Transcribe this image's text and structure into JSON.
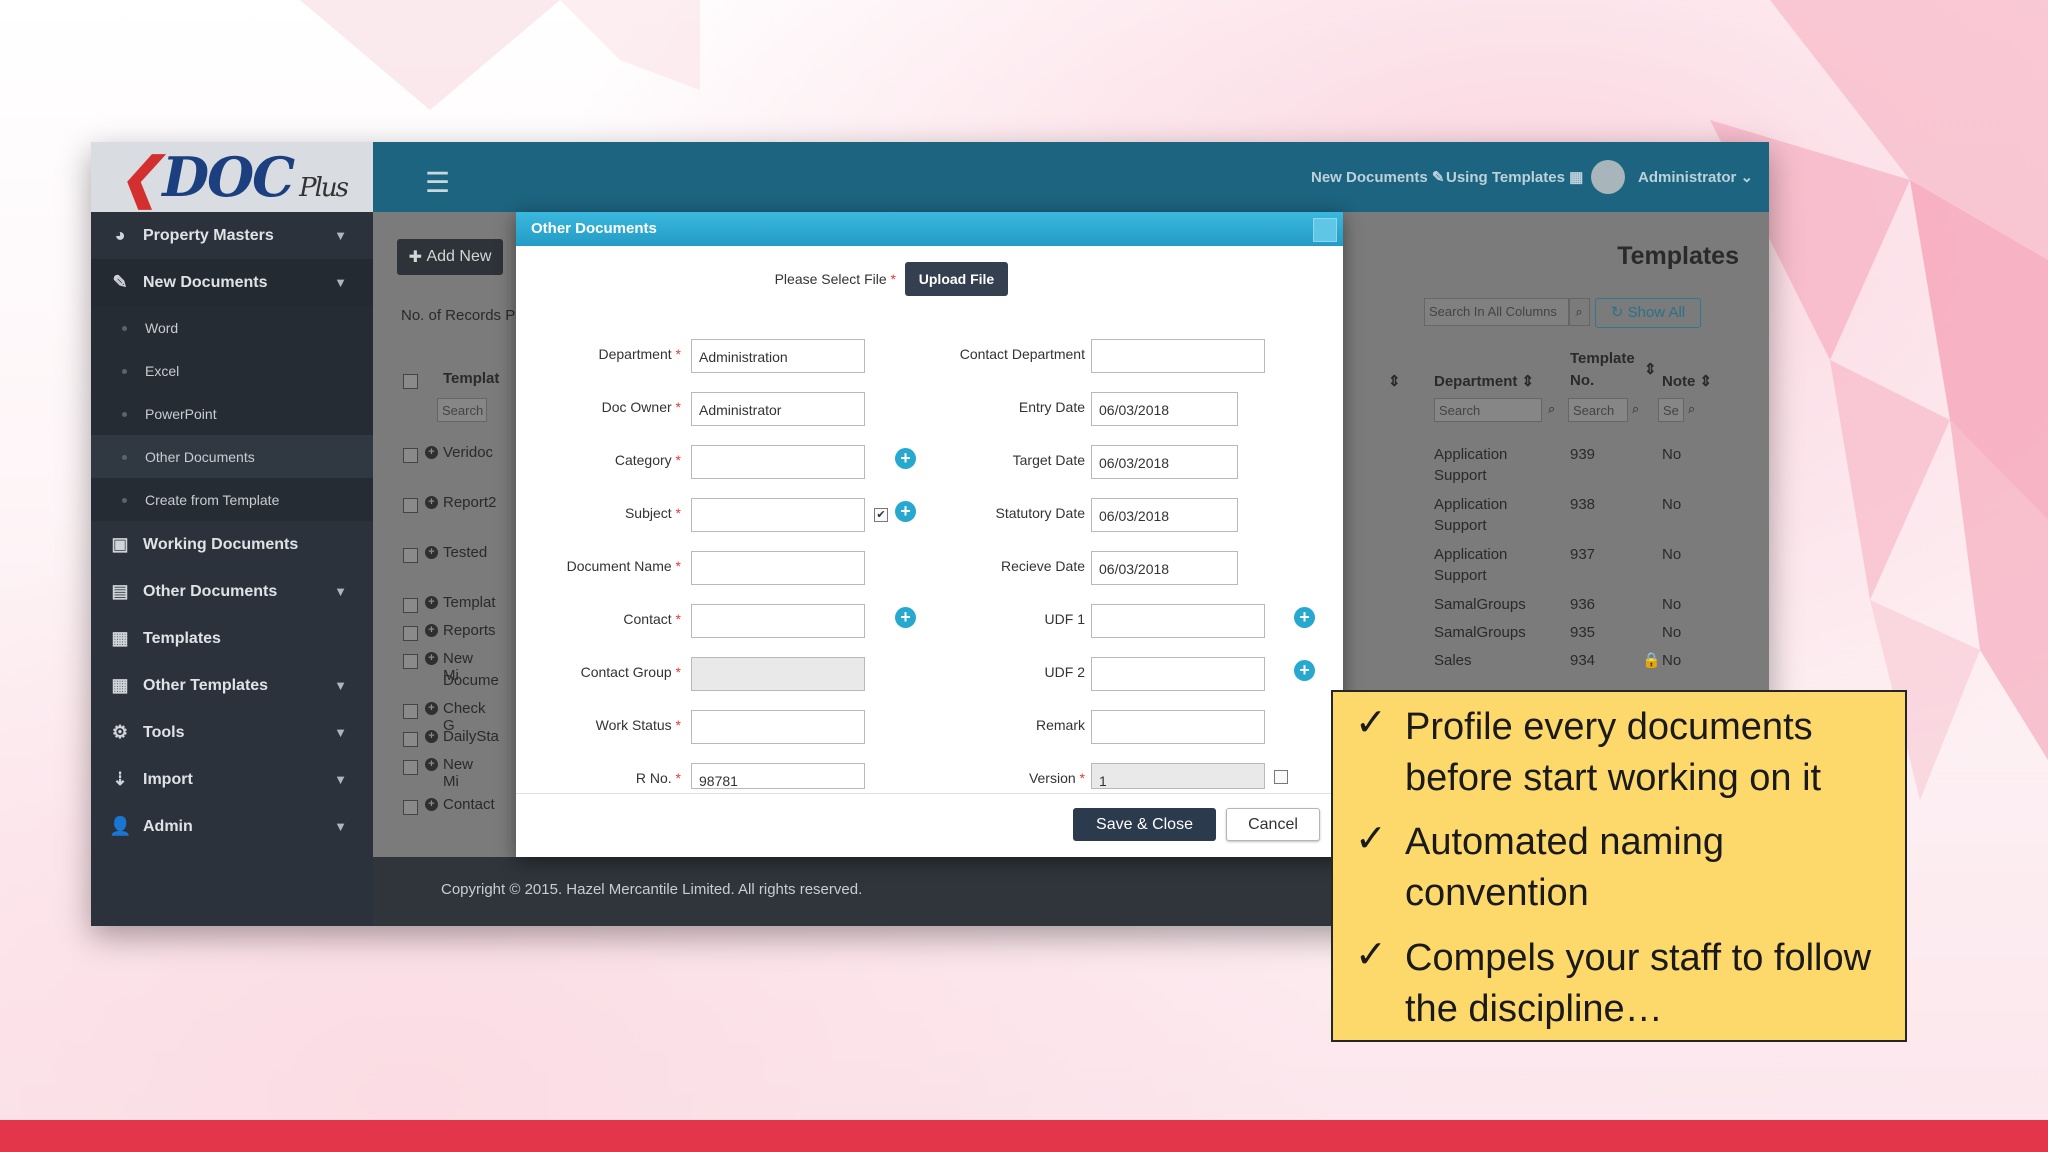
{
  "app": {
    "logo_text": "DOC",
    "logo_suffix": "Plus"
  },
  "sidebar": {
    "items": [
      {
        "label": "Property Masters",
        "icon": "dashboard-icon"
      },
      {
        "label": "New Documents",
        "icon": "edit-icon"
      },
      {
        "label": "Working Documents",
        "icon": "excel-file-icon"
      },
      {
        "label": "Other Documents",
        "icon": "file-icon"
      },
      {
        "label": "Templates",
        "icon": "grid-icon"
      },
      {
        "label": "Other Templates",
        "icon": "table-icon"
      },
      {
        "label": "Tools",
        "icon": "gear-icon"
      },
      {
        "label": "Import",
        "icon": "import-icon"
      },
      {
        "label": "Admin",
        "icon": "user-icon"
      }
    ],
    "sub_items": [
      "Word",
      "Excel",
      "PowerPoint",
      "Other Documents",
      "Create from Template"
    ]
  },
  "topbar": {
    "new_documents": "New Documents",
    "using_templates": "Using Templates",
    "user": "Administrator"
  },
  "page": {
    "add_new": "Add New",
    "records_label": "No. of Records P",
    "title": "Templates",
    "search_all_placeholder": "Search In All Columns",
    "show_all": "Show All"
  },
  "left_table": {
    "header": "Templat",
    "search": "Search",
    "rows": [
      "Veridoc",
      "Report2",
      "Tested",
      "Templat",
      "Reports",
      "New Mi",
      "Docume",
      "Check G",
      "DailySta",
      "New Mi",
      "Contact"
    ]
  },
  "right_table": {
    "headers": {
      "department": "Department",
      "template_no_1": "Template",
      "template_no_2": "No.",
      "note": "Note"
    },
    "search": "Search",
    "search_short": "Se",
    "rows": [
      {
        "dept1": "Application",
        "dept2": "Support",
        "no": "939",
        "note": "No"
      },
      {
        "dept1": "Application",
        "dept2": "Support",
        "no": "938",
        "note": "No"
      },
      {
        "dept1": "Application",
        "dept2": "Support",
        "no": "937",
        "note": "No"
      },
      {
        "dept1": "SamalGroups",
        "dept2": "",
        "no": "936",
        "note": "No"
      },
      {
        "dept1": "SamalGroups",
        "dept2": "",
        "no": "935",
        "note": "No"
      },
      {
        "dept1": "Sales",
        "dept2": "",
        "no": "934",
        "note": "No"
      }
    ]
  },
  "footer": {
    "text": "Copyright © 2015. Hazel Mercantile Limited. All rights reserved."
  },
  "modal": {
    "title": "Other Documents",
    "select_file_label": "Please Select File",
    "upload_button": "Upload File",
    "fields": {
      "department": {
        "label": "Department",
        "value": "Administration"
      },
      "doc_owner": {
        "label": "Doc Owner",
        "value": "Administrator"
      },
      "category": {
        "label": "Category",
        "value": ""
      },
      "subject": {
        "label": "Subject",
        "value": ""
      },
      "document_name": {
        "label": "Document Name",
        "value": ""
      },
      "contact": {
        "label": "Contact",
        "value": ""
      },
      "contact_group": {
        "label": "Contact Group",
        "value": ""
      },
      "work_status": {
        "label": "Work Status",
        "value": ""
      },
      "r_no": {
        "label": "R No.",
        "value": "98781"
      },
      "contact_department": {
        "label": "Contact Department",
        "value": ""
      },
      "entry_date": {
        "label": "Entry Date",
        "value": "06/03/2018"
      },
      "target_date": {
        "label": "Target Date",
        "value": "06/03/2018"
      },
      "statutory_date": {
        "label": "Statutory Date",
        "value": "06/03/2018"
      },
      "recieve_date": {
        "label": "Recieve Date",
        "value": "06/03/2018"
      },
      "udf1": {
        "label": "UDF 1",
        "value": ""
      },
      "udf2": {
        "label": "UDF 2",
        "value": ""
      },
      "remark": {
        "label": "Remark",
        "value": ""
      },
      "version": {
        "label": "Version",
        "value": "1"
      }
    },
    "save_button": "Save & Close",
    "cancel_button": "Cancel"
  },
  "callout": {
    "bullets": [
      {
        "line1": "Profile every documents",
        "line2": "before start working on it"
      },
      {
        "line1": "Automated naming",
        "line2": "convention"
      },
      {
        "line1": "Compels your staff to follow",
        "line2": "the discipline…"
      }
    ]
  },
  "colors": {
    "accent": "#27a8cf",
    "topbar": "#1d6480",
    "sidebar": "#2b323b",
    "callout": "#fdd86a",
    "bottom_bar": "#e4364a"
  }
}
